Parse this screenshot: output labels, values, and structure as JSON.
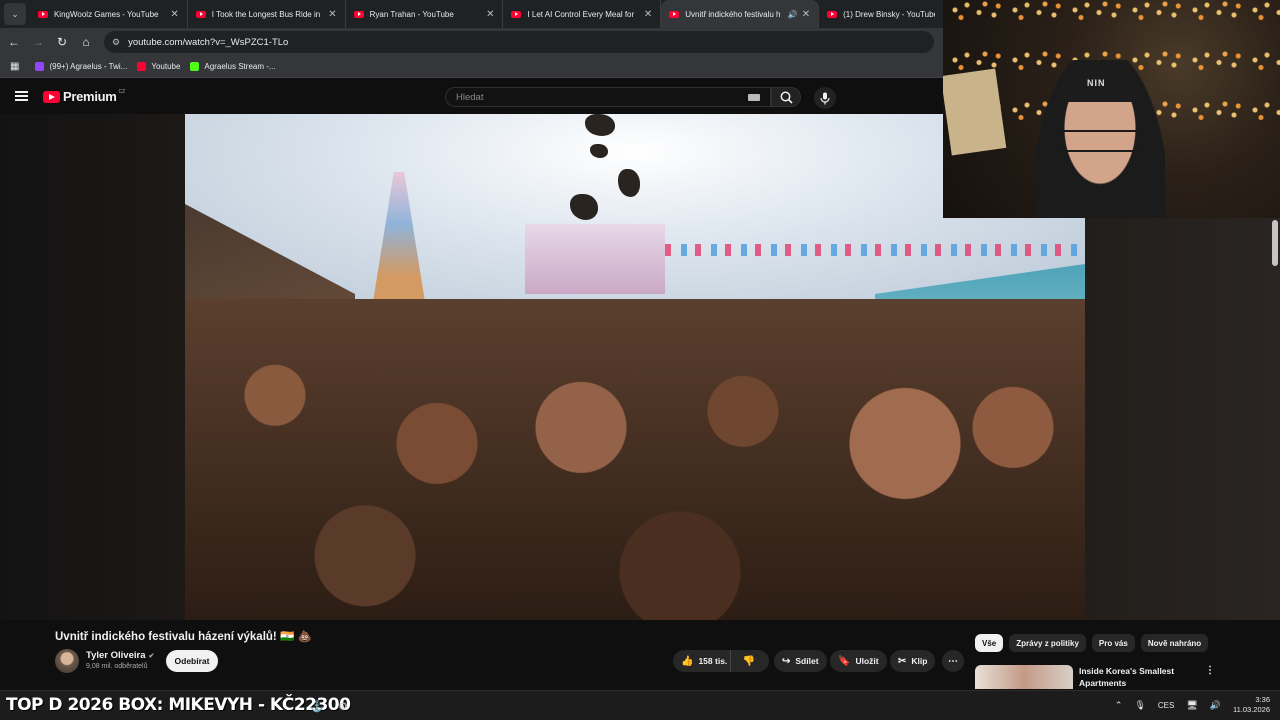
{
  "browser": {
    "tabs": [
      {
        "title": "KingWoolz Games - YouTube",
        "active": false
      },
      {
        "title": "I Took the Longest Bus Ride in",
        "active": false
      },
      {
        "title": "Ryan Trahan - YouTube",
        "active": false
      },
      {
        "title": "I Let AI Control Every Meal for",
        "active": false
      },
      {
        "title": "Uvnitř indického festivalu h",
        "active": true
      },
      {
        "title": "(1) Drew Binsky - YouTube",
        "active": false
      }
    ],
    "url": "youtube.com/watch?v=_WsPZC1-TLo",
    "bookmarks": [
      {
        "label": "(99+) Agraelus - Twi...",
        "color": "#9146ff"
      },
      {
        "label": "Youtube",
        "color": "#ff0033"
      },
      {
        "label": "Agraelus Stream -...",
        "color": "#53fc18"
      }
    ]
  },
  "youtube": {
    "logo_text": "Premium",
    "country": "CZ",
    "search_placeholder": "Hledat",
    "video_title": "Uvnitř indického festivalu házení výkalů! 🇮🇳 💩",
    "channel_name": "Tyler Oliveira",
    "subscribers": "9,08 mil. odběratelů",
    "subscribe_label": "Odebírat",
    "likes": "158 tis.",
    "share_label": "Sdílet",
    "save_label": "Uložit",
    "clip_label": "Klip",
    "chips": [
      "Vše",
      "Zprávy z politiky",
      "Pro vás",
      "Nově nahráno"
    ],
    "recommendation_title": "Inside Korea's Smallest Apartments"
  },
  "taskbar": {
    "ticker": "TOP D 2026 BOX: MIKEVYH - KČ22300",
    "language": "CES",
    "time": "3:36",
    "date": "11.03.2026"
  },
  "webcam": {
    "cap_logo": "NIN"
  },
  "colors": {
    "youtube_red": "#ff0033",
    "background": "#0f0f0f",
    "chrome_tab": "#35363a"
  }
}
